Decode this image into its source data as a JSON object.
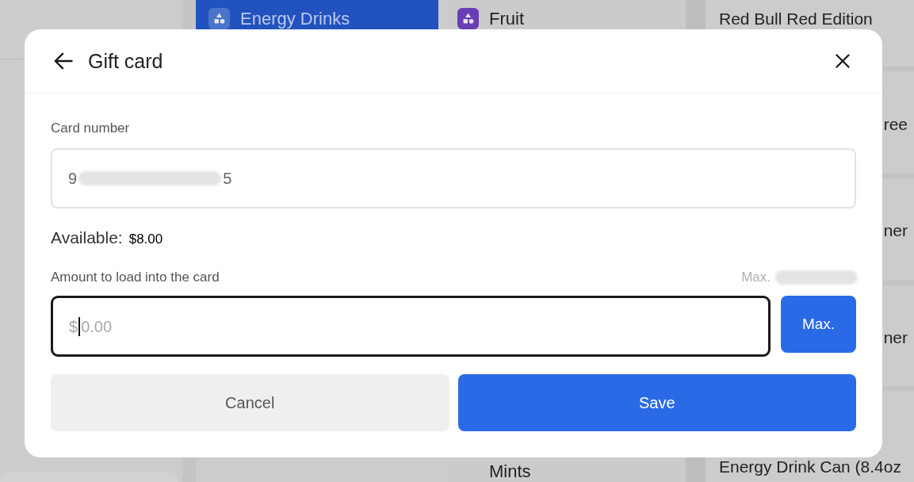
{
  "background": {
    "categories": [
      {
        "label": "Energy Drinks",
        "selected": true,
        "color": "#4a73cc"
      },
      {
        "label": "Fruit",
        "selected": false,
        "color": "#6a3db5"
      },
      {
        "label": "Mints",
        "selected": false
      }
    ],
    "products": [
      {
        "name": "Red Bull Red Edition",
        "kind": "full"
      },
      {
        "name": "ree",
        "kind": "clipped"
      },
      {
        "name": "ner",
        "kind": "clipped"
      },
      {
        "name": "ner",
        "kind": "clipped"
      },
      {
        "name": "Energy Drink Can (8.4oz",
        "kind": "full"
      }
    ]
  },
  "dialog": {
    "title": "Gift card",
    "card_number": {
      "label": "Card number",
      "value_start": "9",
      "redacted": true,
      "value_end": "5"
    },
    "available": {
      "label": "Available:",
      "amount": "$8.00"
    },
    "amount": {
      "label": "Amount to load into the card",
      "max_label": "Max.",
      "max_redacted": true,
      "prefix": "$",
      "placeholder": "0.00",
      "focused": true
    },
    "max_button": "Max.",
    "buttons": [
      {
        "label": "Cancel",
        "kind": "secondary"
      },
      {
        "label": "Save",
        "kind": "primary"
      }
    ]
  }
}
